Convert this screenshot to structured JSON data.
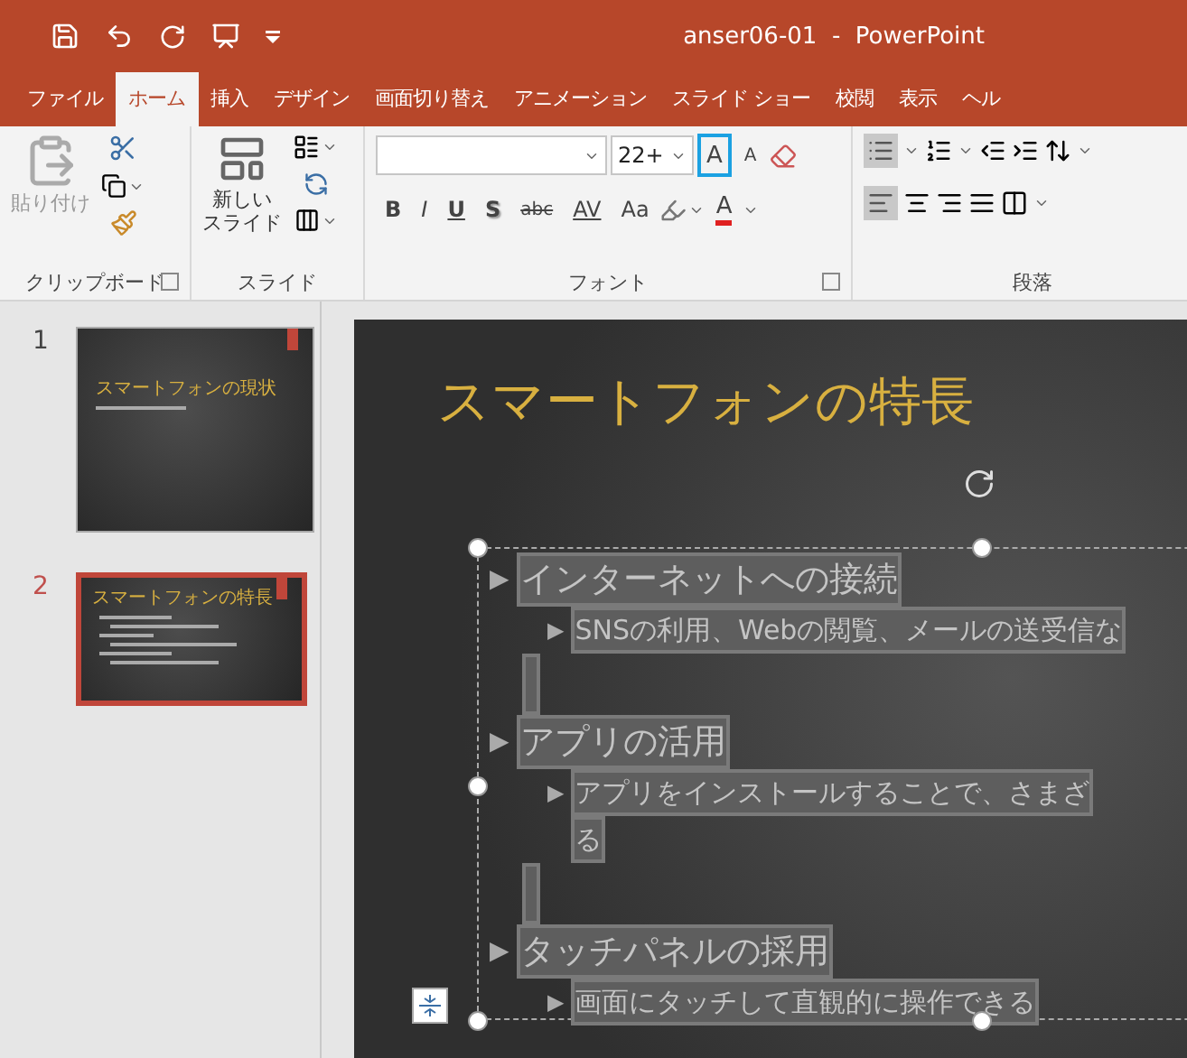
{
  "window": {
    "title": "anser06-01  -  PowerPoint"
  },
  "tabs": [
    {
      "label": "ファイル",
      "selected": false
    },
    {
      "label": "ホーム",
      "selected": true
    },
    {
      "label": "挿入",
      "selected": false
    },
    {
      "label": "デザイン",
      "selected": false
    },
    {
      "label": "画面切り替え",
      "selected": false
    },
    {
      "label": "アニメーション",
      "selected": false
    },
    {
      "label": "スライド ショー",
      "selected": false
    },
    {
      "label": "校閲",
      "selected": false
    },
    {
      "label": "表示",
      "selected": false
    },
    {
      "label": "ヘル",
      "selected": false
    }
  ],
  "ribbon": {
    "clipboard": {
      "paste": "貼り付け",
      "label": "クリップボード"
    },
    "slides": {
      "new_slide": [
        "新しい",
        "スライド"
      ],
      "label": "スライド"
    },
    "font": {
      "font_size": "22+",
      "label": "フォント",
      "grow_highlighted": true,
      "buttons": [
        {
          "kind": "bold",
          "text": "B"
        },
        {
          "kind": "italic",
          "text": "I"
        },
        {
          "kind": "underline",
          "text": "U"
        },
        {
          "kind": "shadow",
          "text": "S"
        },
        {
          "kind": "strike",
          "text": "abc"
        },
        {
          "kind": "spacing",
          "text": "AV"
        },
        {
          "kind": "case",
          "text": "Aa"
        }
      ],
      "grow_text": "A",
      "shrink_text": "A",
      "color_text": "A"
    },
    "paragraph": {
      "label": "段落",
      "bullets_on": true,
      "align_left_on": true
    }
  },
  "slides": [
    {
      "number": "1",
      "title": "スマートフォンの現状",
      "selected": false
    },
    {
      "number": "2",
      "title": "スマートフォンの特長",
      "selected": true
    }
  ],
  "slide": {
    "title": "スマートフォンの特長",
    "body": [
      {
        "bullet": "▶",
        "text": "インターネットへの接続",
        "children": [
          {
            "bullet": "▶",
            "lines": [
              "SNSの利用、Webの閲覧、メールの送受信な"
            ]
          }
        ]
      },
      {
        "bullet": "▶",
        "text": "アプリの活用",
        "children": [
          {
            "bullet": "▶",
            "lines": [
              "アプリをインストールすることで、さまざ",
              "る"
            ]
          }
        ]
      },
      {
        "bullet": "▶",
        "text": "タッチパネルの採用",
        "children": [
          {
            "bullet": "▶",
            "lines": [
              "画面にタッチして直観的に操作できる"
            ]
          }
        ]
      }
    ]
  }
}
